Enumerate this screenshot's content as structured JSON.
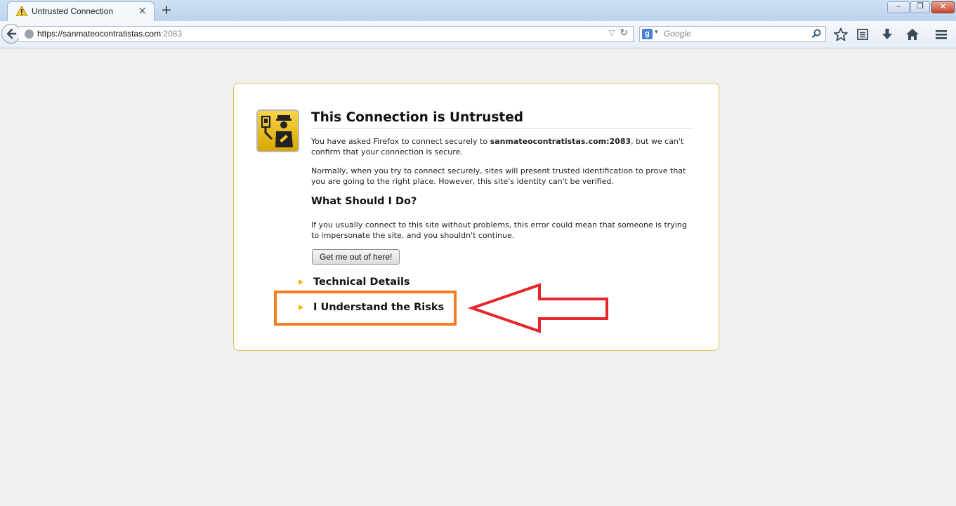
{
  "browser": {
    "tab_title": "Untrusted Connection",
    "new_tab_symbol": "+",
    "tab_close_symbol": "×",
    "url_host": "https://sanmateocontratistas.com",
    "url_port": ":2083",
    "search_placeholder": "Google",
    "search_engine_badge": "g",
    "window_controls": {
      "minimize": "–",
      "maximize": "❐",
      "close": "✕"
    }
  },
  "page": {
    "title": "This Connection is Untrusted",
    "p1_before": "You have asked Firefox to connect securely to ",
    "p1_host": "sanmateocontratistas.com:2083",
    "p1_after": ", but we can't confirm that your connection is secure.",
    "p2": "Normally, when you try to connect securely, sites will present trusted identification to prove that you are going to the right place. However, this site's identity can't be verified.",
    "what_heading": "What Should I Do?",
    "p3": "If you usually connect to this site without problems, this error could mean that someone is trying to impersonate the site, and you shouldn't continue.",
    "get_out_button": "Get me out of here!",
    "technical_details": "Technical Details",
    "understand_risks": "I Understand the Risks"
  },
  "colors": {
    "card_border": "#e3c15c",
    "expander_triangle": "#f0b800",
    "highlight_box": "#f57d1f",
    "arrow": "#e8262a"
  },
  "icons": [
    "warning-icon",
    "back-arrow-icon",
    "globe-icon",
    "reload-icon",
    "search-magnifier-icon",
    "bookmark-star-icon",
    "bookmarks-list-icon",
    "download-icon",
    "home-icon",
    "menu-icon",
    "certificate-officer-icon"
  ]
}
